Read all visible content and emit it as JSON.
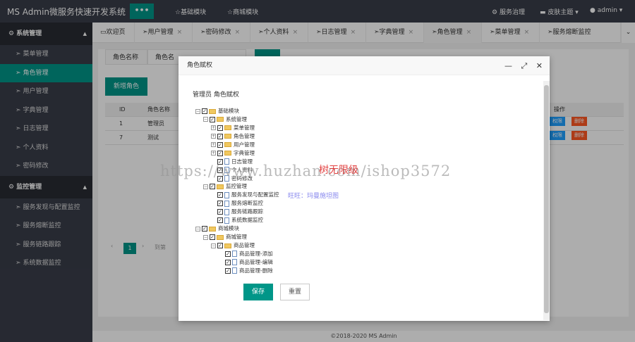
{
  "app": {
    "title": "MS Admin微服务快速开发系统",
    "toggle_label": "•••"
  },
  "header": {
    "nav": [
      {
        "icon": "star-icon",
        "label": "☆基础模块"
      },
      {
        "icon": "star-icon",
        "label": "☆商城模块"
      }
    ],
    "right": {
      "service": "服务治理",
      "theme": "皮肤主题",
      "user": "admin"
    }
  },
  "sidebar": {
    "groups": [
      {
        "label": "系统管理",
        "items": [
          "菜单管理",
          "角色管理",
          "用户管理",
          "字典管理",
          "日志管理",
          "个人资料",
          "密码修改"
        ]
      },
      {
        "label": "监控管理",
        "items": [
          "服务发现与配置监控",
          "服务熔断监控",
          "服务链路跟踪",
          "系统数据监控"
        ]
      }
    ],
    "active_item": "角色管理"
  },
  "tabs": [
    {
      "label": "欢迎页",
      "closable": false
    },
    {
      "label": "用户管理",
      "closable": true
    },
    {
      "label": "密码修改",
      "closable": true
    },
    {
      "label": "个人资料",
      "closable": true
    },
    {
      "label": "日志管理",
      "closable": true
    },
    {
      "label": "字典管理",
      "closable": true
    },
    {
      "label": "角色管理",
      "closable": true,
      "active": true
    },
    {
      "label": "菜单管理",
      "closable": true
    },
    {
      "label": "服务熔断监控",
      "closable": false
    }
  ],
  "content": {
    "search_label": "角色名称",
    "search_placeholder": "角色名",
    "add_button": "新增角色",
    "table": {
      "headers": [
        "ID",
        "角色名称",
        "操作"
      ],
      "rows": [
        {
          "id": "1",
          "name": "管理员",
          "actions": [
            "权限",
            "删除"
          ]
        },
        {
          "id": "7",
          "name": "测试",
          "actions": [
            "权限",
            "删除"
          ]
        }
      ]
    },
    "pager": {
      "current": "1",
      "goto": "到第"
    }
  },
  "footer": "©2018-2020 MS Admin",
  "modal": {
    "title": "角色赋权",
    "heading": "管理员 角色赋权",
    "save": "保存",
    "reset": "重置",
    "tree": [
      {
        "label": "基础模块",
        "type": "folder"
      },
      {
        "label": "系统管理",
        "type": "folder"
      },
      {
        "label": "菜单管理",
        "type": "folder"
      },
      {
        "label": "角色管理",
        "type": "folder"
      },
      {
        "label": "用户管理",
        "type": "folder"
      },
      {
        "label": "字典管理",
        "type": "folder"
      },
      {
        "label": "日志管理",
        "type": "file"
      },
      {
        "label": "个人资料",
        "type": "file"
      },
      {
        "label": "密码修改",
        "type": "file"
      },
      {
        "label": "监控管理",
        "type": "folder"
      },
      {
        "label": "服务发现与配置监控",
        "type": "file"
      },
      {
        "label": "服务熔断监控",
        "type": "file"
      },
      {
        "label": "服务链路跟踪",
        "type": "file"
      },
      {
        "label": "系统数据监控",
        "type": "file"
      },
      {
        "label": "商城模块",
        "type": "folder"
      },
      {
        "label": "商城管理",
        "type": "folder"
      },
      {
        "label": "商品管理",
        "type": "folder"
      },
      {
        "label": "商品管理-添加",
        "type": "file"
      },
      {
        "label": "商品管理-编辑",
        "type": "file"
      },
      {
        "label": "商品管理-删除",
        "type": "file"
      }
    ]
  },
  "watermark": {
    "url": "https://www.huzhan.com/ishop3572",
    "red": "树无限级",
    "blue": "旺旺：玛曼施坦图"
  },
  "colors": {
    "primary": "#009688",
    "dark": "#393d49",
    "blue": "#1e9fff",
    "red": "#ff5722"
  }
}
